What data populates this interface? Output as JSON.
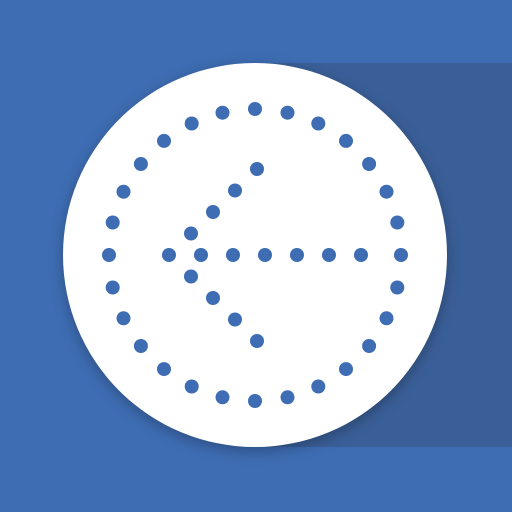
{
  "icon": {
    "name": "dotted-circle-back-arrow-icon",
    "background_color": "#3e6db3",
    "shadow_color": "#3a5f98",
    "disc_color": "#ffffff",
    "dot_color": "#3e6db3"
  }
}
